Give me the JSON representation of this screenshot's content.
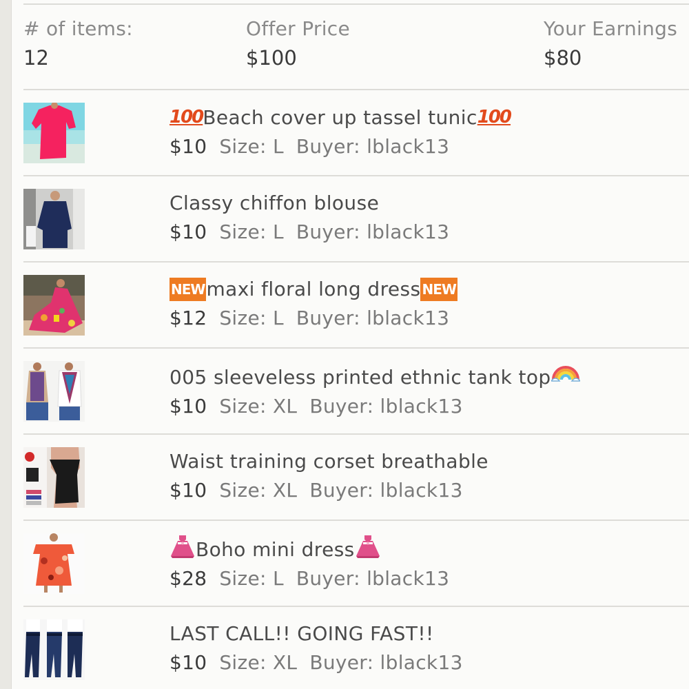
{
  "summary": {
    "items_label": "# of items:",
    "items_value": "12",
    "offer_label": "Offer Price",
    "offer_value": "$100",
    "earnings_label": "Your Earnings",
    "earnings_value": "$80"
  },
  "icons": {
    "hundred_text": "100",
    "new_text": "NEW"
  },
  "items": [
    {
      "title": "Beach cover up tassel tunic",
      "price": "$10",
      "size": "Size: L",
      "buyer": "Buyer: lblack13"
    },
    {
      "title": "Classy chiffon blouse",
      "price": "$10",
      "size": "Size: L",
      "buyer": "Buyer: lblack13"
    },
    {
      "title": "maxi floral long dress",
      "price": "$12",
      "size": "Size: L",
      "buyer": "Buyer: lblack13"
    },
    {
      "title": "005 sleeveless printed ethnic tank top",
      "price": "$10",
      "size": "Size: XL",
      "buyer": "Buyer: lblack13"
    },
    {
      "title": "Waist training corset breathable",
      "price": "$10",
      "size": "Size: XL",
      "buyer": "Buyer: lblack13"
    },
    {
      "title": "Boho mini dress",
      "price": "$28",
      "size": "Size: L",
      "buyer": "Buyer: lblack13"
    },
    {
      "title": "LAST CALL!! GOING FAST!!",
      "price": "$10",
      "size": "Size: XL",
      "buyer": "Buyer: lblack13"
    }
  ],
  "colors": {
    "accent_orange": "#ee7b22",
    "hundred_red": "#e24a1c",
    "dress_pink": "#e0508a"
  }
}
